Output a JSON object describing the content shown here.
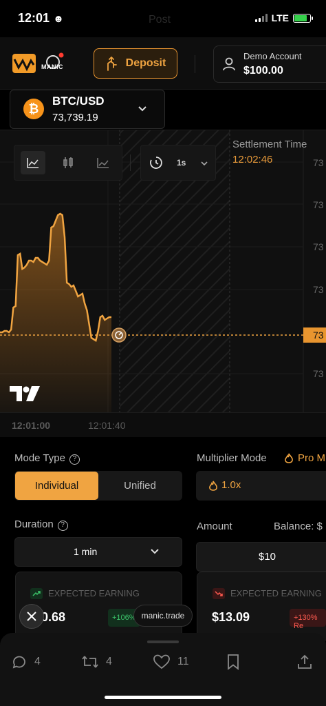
{
  "status_bar": {
    "time": "12:01",
    "face": "☻",
    "ghost_text": "Post",
    "network": "LTE"
  },
  "header": {
    "brand": "MANIC",
    "deposit_label": "Deposit",
    "account_label": "Demo Account",
    "account_balance": "$100.00"
  },
  "pair": {
    "symbol": "₿",
    "name": "BTC/USD",
    "price": "73,739.19"
  },
  "chart_toolbar": {
    "interval": "1s",
    "settlement_label": "Settlement Time",
    "settlement_time": "12:02:46",
    "price_ticks": [
      "73",
      "73",
      "73",
      "73",
      "73"
    ],
    "current_price_tag": "73",
    "time_ticks": [
      "12:01:00",
      "12:01:40"
    ]
  },
  "chart_data": {
    "type": "area",
    "x": [
      0,
      2,
      4,
      6,
      8,
      10,
      12,
      14,
      16,
      18,
      20,
      22,
      24,
      26,
      28,
      30,
      32,
      34,
      36,
      38,
      40,
      42,
      44,
      46,
      48,
      50,
      52,
      54,
      56,
      58,
      60,
      62,
      64,
      66,
      68,
      70,
      72,
      74,
      76,
      78,
      80,
      82,
      84,
      86,
      88,
      90,
      92,
      94,
      96,
      98,
      100
    ],
    "y": [
      0.14,
      0.14,
      0.15,
      0.15,
      0.14,
      0.16,
      0.32,
      0.33,
      0.7,
      0.71,
      0.6,
      0.61,
      0.63,
      0.66,
      0.66,
      0.65,
      0.68,
      0.68,
      0.66,
      0.65,
      0.64,
      0.63,
      0.66,
      0.9,
      0.91,
      0.95,
      0.99,
      1.0,
      0.99,
      0.83,
      0.5,
      0.49,
      0.47,
      0.48,
      0.44,
      0.4,
      0.41,
      0.42,
      0.35,
      0.3,
      0.2,
      0.1,
      0.09,
      0.08,
      0.15,
      0.25,
      0.26,
      0.23,
      0.24,
      0.25,
      0.25
    ],
    "color": "#f0a441",
    "grid": true,
    "title": "",
    "xlabel": "",
    "ylabel": ""
  },
  "controls": {
    "mode_label": "Mode Type",
    "mode_individual": "Individual",
    "mode_unified": "Unified",
    "multiplier_label": "Multiplier Mode",
    "pro_label": "Pro M",
    "multiplier_value": "1.0x",
    "duration_label": "Duration",
    "duration_value": "1 min",
    "amount_label": "Amount",
    "balance_label": "Balance: $",
    "amount_value": "$10",
    "help_glyph": "?"
  },
  "earnings": {
    "left_label": "EXPECTED EARNING",
    "left_value": "0.68",
    "left_badge": "+106%",
    "right_label": "EXPECTED EARNING",
    "right_value": "$13.09",
    "right_badge": "+130% Re"
  },
  "overlay": {
    "domain_pill": "manic.trade"
  },
  "actions": {
    "replies": "4",
    "reposts": "4",
    "likes": "11"
  },
  "colors": {
    "accent": "#f0a441",
    "background": "#000000",
    "panel": "#181818"
  }
}
